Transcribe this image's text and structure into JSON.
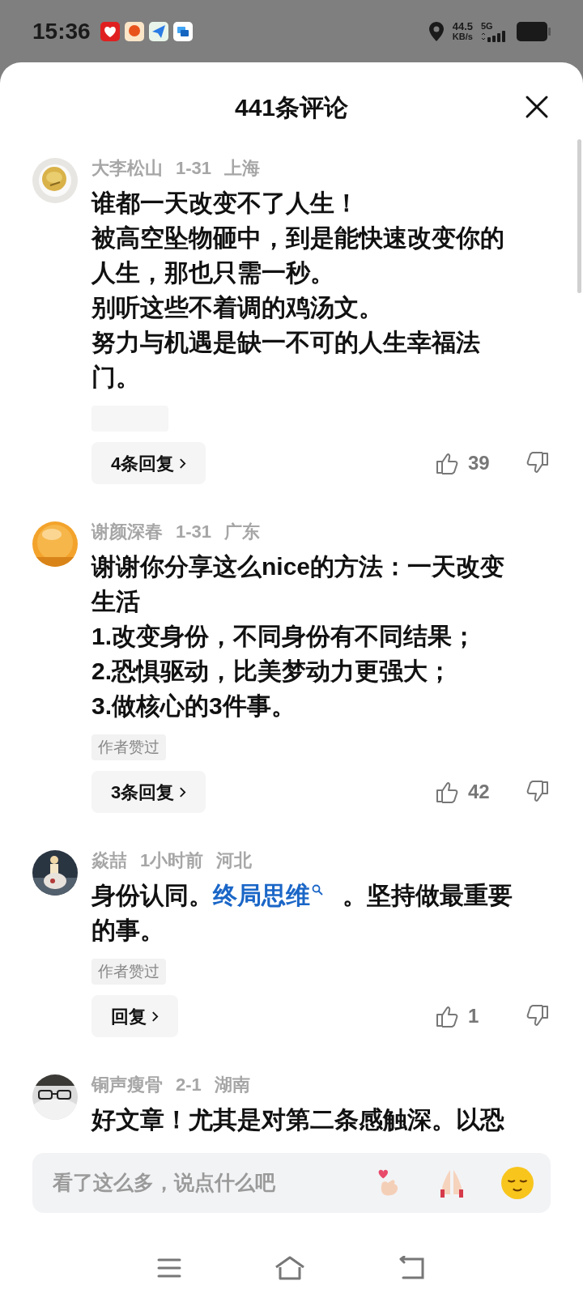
{
  "status_bar": {
    "time": "15:36",
    "net_speed": "44.5",
    "net_unit": "KB/s",
    "network": "5G"
  },
  "title": "441条评论",
  "comments": [
    {
      "user": "大李松山",
      "date": "1-31",
      "location": "上海",
      "paragraphs": [
        [
          {
            "kind": "text",
            "text": "谁都一天改变不了人生！"
          }
        ],
        [
          {
            "kind": "text",
            "text": "被高空坠物砸中，到是能快速改变你的人生，那也只需一秒。"
          }
        ],
        [
          {
            "kind": "text",
            "text": "别听这些不着调的鸡汤文。"
          }
        ],
        [
          {
            "kind": "text",
            "text": "努力与机遇是缺一不可的人生幸福法门。"
          }
        ]
      ],
      "tag": {
        "kind": "blurred"
      },
      "replies": "4条回复",
      "likes": "39"
    },
    {
      "user": "谢颜深春",
      "date": "1-31",
      "location": "广东",
      "paragraphs": [
        [
          {
            "kind": "text",
            "text": "谢谢你分享这么nice的方法：一天改变生活"
          }
        ],
        [
          {
            "kind": "text",
            "text": "1.改变身份，不同身份有不同结果；"
          }
        ],
        [
          {
            "kind": "text",
            "text": "2.恐惧驱动，比美梦动力更强大；"
          }
        ],
        [
          {
            "kind": "text",
            "text": "3.做核心的3件事。"
          }
        ]
      ],
      "tag": {
        "kind": "label",
        "text": "作者赞过"
      },
      "replies": "3条回复",
      "likes": "42"
    },
    {
      "user": "焱喆",
      "date": "1小时前",
      "location": "河北",
      "paragraphs": [
        [
          {
            "kind": "text",
            "text": "身份认同。"
          },
          {
            "kind": "link",
            "text": "终局思维"
          },
          {
            "kind": "text",
            "text": "。坚持做最重要的事。"
          }
        ]
      ],
      "tag": {
        "kind": "label",
        "text": "作者赞过"
      },
      "replies": "回复",
      "likes": "1"
    },
    {
      "user": "铜声瘦骨",
      "date": "2-1",
      "location": "湖南",
      "paragraphs": [
        [
          {
            "kind": "text",
            "text": "好文章！尤其是对第二条感触深。以恐"
          }
        ]
      ]
    }
  ],
  "input": {
    "placeholder": "看了这么多，说点什么吧"
  }
}
